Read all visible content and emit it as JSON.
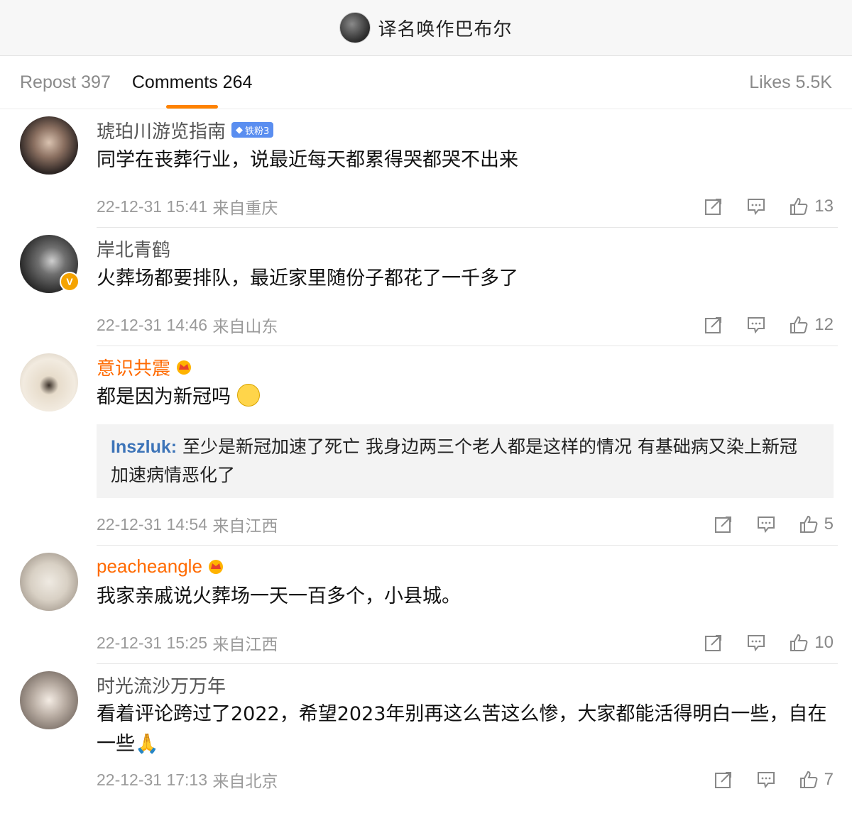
{
  "header": {
    "title": "译名唤作巴布尔"
  },
  "tabs": {
    "repost": "Repost 397",
    "comments": "Comments 264",
    "likes": "Likes 5.5K"
  },
  "comments": [
    {
      "name": "琥珀川游览指南",
      "badge": "铁粉3",
      "text": "同学在丧葬行业，说最近每天都累得哭都哭不出来",
      "time": "22-12-31 15:41",
      "location": "来自重庆",
      "likes": "13"
    },
    {
      "name": "岸北青鹤",
      "badge_letter": "V",
      "text": "火葬场都要排队，最近家里随份子都花了一千多了",
      "time": "22-12-31 14:46",
      "location": "来自山东",
      "likes": "12"
    },
    {
      "name": "意识共震",
      "text": "都是因为新冠吗",
      "reply_user": "Inszluk:",
      "reply_text": " 至少是新冠加速了死亡 我身边两三个老人都是这样的情况 有基础病又染上新冠 加速病情恶化了",
      "time": "22-12-31 14:54",
      "location": "来自江西",
      "likes": "5"
    },
    {
      "name": "peacheangle",
      "text": "我家亲戚说火葬场一天一百多个，小县城。",
      "time": "22-12-31 15:25",
      "location": "来自江西",
      "likes": "10"
    },
    {
      "name": "时光流沙万万年",
      "text": "看着评论跨过了2022，希望2023年别再这么苦这么惨，大家都能活得明白一些，自在一些",
      "time": "22-12-31 17:13",
      "location": "来自北京",
      "likes": "7"
    }
  ],
  "colors": {
    "accent": "#ff8200",
    "vip_name": "#ff6a00",
    "reply_user": "#3d74b8"
  }
}
